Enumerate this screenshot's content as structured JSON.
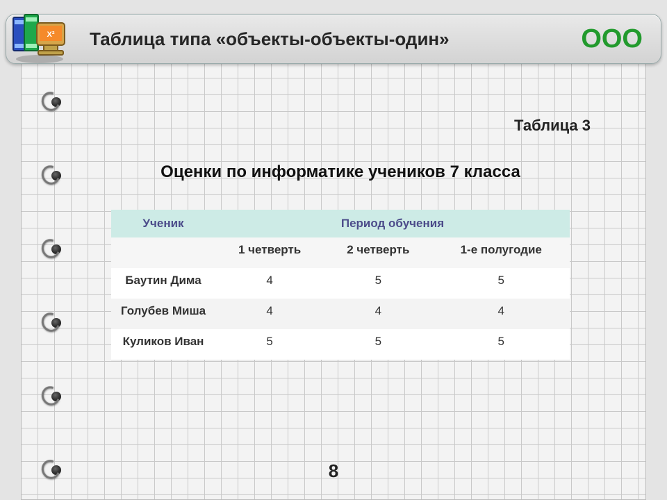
{
  "header": {
    "title": "Таблица типа «объекты-объекты-один»",
    "badge": "ООО"
  },
  "content": {
    "table_tag": "Таблица 3",
    "title": "Оценки по информатике учеников 7 класса",
    "col_student": "Ученик",
    "col_period": "Период обучения",
    "periods": [
      "1 четверть",
      "2 четверть",
      "1-е полугодие"
    ],
    "rows": [
      {
        "name": "Баутин Дима",
        "g": [
          "4",
          "5",
          "5"
        ]
      },
      {
        "name": "Голубев Миша",
        "g": [
          "4",
          "4",
          "4"
        ]
      },
      {
        "name": "Куликов Иван",
        "g": [
          "5",
          "5",
          "5"
        ]
      }
    ]
  },
  "page_number": "8",
  "chart_data": {
    "type": "table",
    "title": "Оценки по информатике учеников 7 класса",
    "columns": [
      "Ученик",
      "1 четверть",
      "2 четверть",
      "1-е полугодие"
    ],
    "rows": [
      [
        "Баутин Дима",
        4,
        5,
        5
      ],
      [
        "Голубев Миша",
        4,
        4,
        4
      ],
      [
        "Куликов Иван",
        5,
        5,
        5
      ]
    ]
  }
}
